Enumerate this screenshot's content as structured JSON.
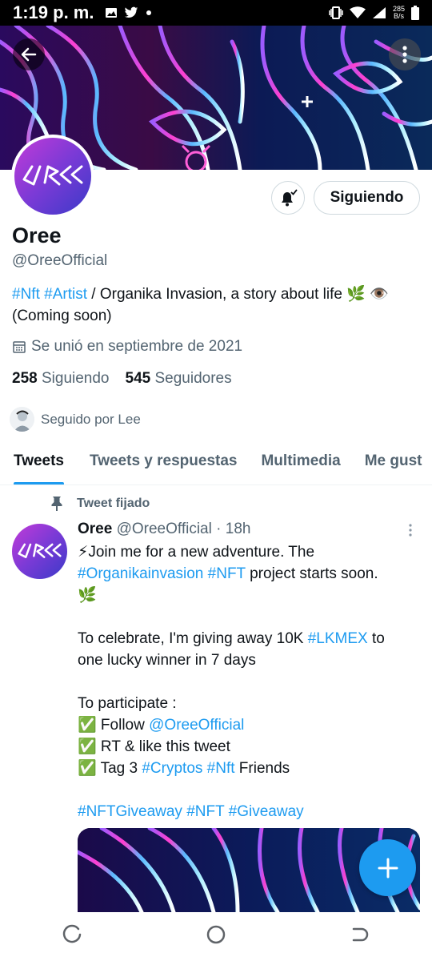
{
  "status_bar": {
    "time": "1:19 p. m.",
    "net_speed_value": "285",
    "net_speed_unit": "B/s",
    "icons": [
      "gallery-icon",
      "twitter-icon",
      "dot-icon",
      "vibrate-icon",
      "wifi-icon",
      "signal-icon",
      "battery-icon"
    ]
  },
  "profile": {
    "name": "Oree",
    "handle": "@OreeOfficial",
    "follow_button_label": "Siguiendo",
    "bio": {
      "hashtag_1": "#Nft",
      "hashtag_2": "#Artist",
      "text": " / Organika Invasion, a story about life 🌿 👁️ (Coming  soon)"
    },
    "joined": "Se unió en septiembre de 2021",
    "following_count": "258",
    "following_label": "Siguiendo",
    "followers_count": "545",
    "followers_label": "Seguidores",
    "followed_by": "Seguido por Lee"
  },
  "tabs": [
    {
      "label": "Tweets",
      "active": true
    },
    {
      "label": "Tweets y respuestas",
      "active": false
    },
    {
      "label": "Multimedia",
      "active": false
    },
    {
      "label": "Me gust",
      "active": false
    }
  ],
  "pinned_tweet": {
    "pinned_label": "Tweet fijado",
    "author_name": "Oree",
    "author_handle": "@OreeOfficial",
    "time": "· 18h",
    "line1": "⚡Join me for a new adventure. The",
    "hashtag_a": "#Organikainvasion",
    "hashtag_b": "#NFT",
    "line2_rest": " project starts soon.",
    "line3": "🌿",
    "celebrate_pre": "To celebrate, I'm giving away 10K ",
    "hashtag_lkmex": "#LKMEX",
    "celebrate_post": " to one lucky winner in 7 days",
    "participate": "To participate :",
    "step1_pre": "✅ Follow ",
    "step1_mention": "@OreeOfficial",
    "step2": "✅ RT & like this tweet",
    "step3_pre": "✅ Tag 3 ",
    "step3_tag1": "#Cryptos",
    "step3_tag2": "#Nft",
    "step3_post": " Friends",
    "tag_line_1": "#NFTGiveaway",
    "tag_line_2": "#NFT",
    "tag_line_3": "#Giveaway"
  },
  "colors": {
    "accent": "#1d9bf0",
    "secondary_text": "#536471",
    "primary_text": "#0f1419"
  }
}
